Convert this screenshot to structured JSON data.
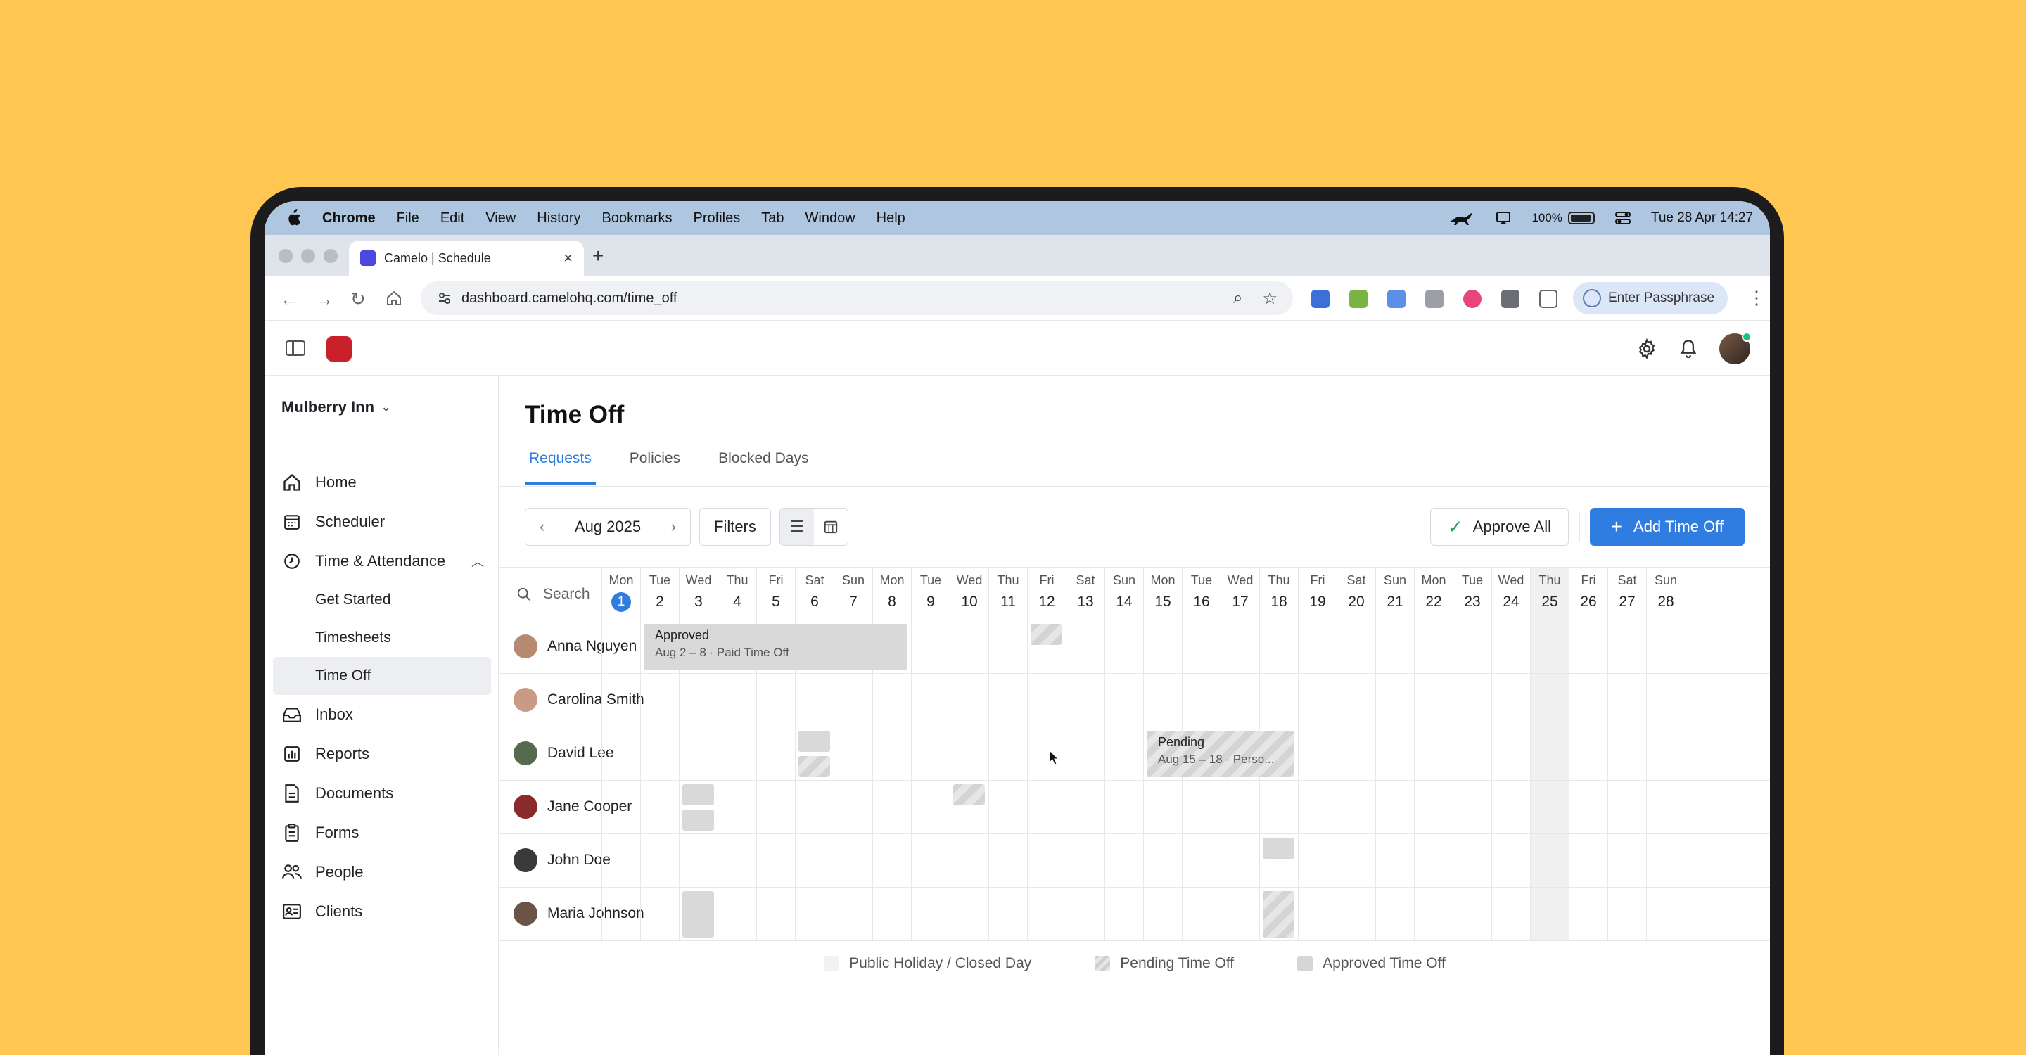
{
  "menubar": {
    "app": "Chrome",
    "menus": [
      "File",
      "Edit",
      "View",
      "History",
      "Bookmarks",
      "Profiles",
      "Tab",
      "Window",
      "Help"
    ],
    "battery": "100%",
    "datetime": "Tue 28 Apr  14:27"
  },
  "browser": {
    "tab_title": "Camelo | Schedule",
    "url": "dashboard.camelohq.com/time_off",
    "passphrase_label": "Enter Passphrase"
  },
  "sidebar": {
    "org": "Mulberry Inn",
    "items": [
      {
        "label": "Home",
        "icon": "home-icon"
      },
      {
        "label": "Scheduler",
        "icon": "calendar-icon"
      },
      {
        "label": "Time & Attendance",
        "icon": "clock-icon"
      }
    ],
    "sub_items": [
      "Get Started",
      "Timesheets",
      "Time Off"
    ],
    "items2": [
      {
        "label": "Inbox",
        "icon": "inbox-icon"
      },
      {
        "label": "Reports",
        "icon": "reports-icon"
      },
      {
        "label": "Documents",
        "icon": "document-icon"
      },
      {
        "label": "Forms",
        "icon": "clipboard-icon"
      },
      {
        "label": "People",
        "icon": "people-icon"
      },
      {
        "label": "Clients",
        "icon": "contact-card-icon"
      }
    ]
  },
  "main": {
    "title": "Time Off",
    "tabs": [
      "Requests",
      "Policies",
      "Blocked Days"
    ],
    "month": "Aug 2025",
    "filters_label": "Filters",
    "approve_all_label": "Approve All",
    "add_label": "Add Time Off",
    "search_placeholder": "Search"
  },
  "calendar": {
    "days": [
      [
        "Mon",
        "1"
      ],
      [
        "Tue",
        "2"
      ],
      [
        "Wed",
        "3"
      ],
      [
        "Thu",
        "4"
      ],
      [
        "Fri",
        "5"
      ],
      [
        "Sat",
        "6"
      ],
      [
        "Sun",
        "7"
      ],
      [
        "Mon",
        "8"
      ],
      [
        "Tue",
        "9"
      ],
      [
        "Wed",
        "10"
      ],
      [
        "Thu",
        "11"
      ],
      [
        "Fri",
        "12"
      ],
      [
        "Sat",
        "13"
      ],
      [
        "Sun",
        "14"
      ],
      [
        "Mon",
        "15"
      ],
      [
        "Tue",
        "16"
      ],
      [
        "Wed",
        "17"
      ],
      [
        "Thu",
        "18"
      ],
      [
        "Fri",
        "19"
      ],
      [
        "Sat",
        "20"
      ],
      [
        "Sun",
        "21"
      ],
      [
        "Mon",
        "22"
      ],
      [
        "Tue",
        "23"
      ],
      [
        "Wed",
        "24"
      ],
      [
        "Thu",
        "25"
      ],
      [
        "Fri",
        "26"
      ],
      [
        "Sat",
        "27"
      ],
      [
        "Sun",
        "28"
      ]
    ],
    "today_index": 0,
    "highlight_index": 24,
    "employees": [
      {
        "name": "Anna Nguyen",
        "avatar_color": "#b58a70"
      },
      {
        "name": "Carolina Smith",
        "avatar_color": "#c99a86"
      },
      {
        "name": "David Lee",
        "avatar_color": "#556b4e"
      },
      {
        "name": "Jane Cooper",
        "avatar_color": "#8a2a2a"
      },
      {
        "name": "John Doe",
        "avatar_color": "#3a3a3a"
      },
      {
        "name": "Maria Johnson",
        "avatar_color": "#6b5446"
      }
    ],
    "blocks": [
      {
        "row": 0,
        "start": 1,
        "end": 7,
        "status": "approved",
        "title": "Approved",
        "subtitle": "Aug 2 – 8 · Paid Time Off",
        "part": "full"
      },
      {
        "row": 0,
        "start": 11,
        "end": 11,
        "status": "pending",
        "part": "top"
      },
      {
        "row": 2,
        "start": 5,
        "end": 5,
        "status": "approved",
        "part": "top"
      },
      {
        "row": 2,
        "start": 5,
        "end": 5,
        "status": "pending",
        "part": "bottom"
      },
      {
        "row": 2,
        "start": 14,
        "end": 17,
        "status": "pending",
        "title": "Pending",
        "subtitle": "Aug 15 – 18 · Perso...",
        "part": "full"
      },
      {
        "row": 3,
        "start": 2,
        "end": 2,
        "status": "approved",
        "part": "top"
      },
      {
        "row": 3,
        "start": 2,
        "end": 2,
        "status": "approved",
        "part": "bottom"
      },
      {
        "row": 3,
        "start": 9,
        "end": 9,
        "status": "pending",
        "part": "top"
      },
      {
        "row": 4,
        "start": 17,
        "end": 17,
        "status": "approved",
        "part": "top"
      },
      {
        "row": 5,
        "start": 2,
        "end": 2,
        "status": "approved",
        "part": "full"
      },
      {
        "row": 5,
        "start": 17,
        "end": 17,
        "status": "pending",
        "part": "full"
      }
    ]
  },
  "legend": [
    "Public Holiday / Closed Day",
    "Pending Time Off",
    "Approved Time Off"
  ],
  "colors": {
    "accent": "#2f7de1",
    "background": "#FFC652",
    "approved": "#d9d9d9"
  }
}
